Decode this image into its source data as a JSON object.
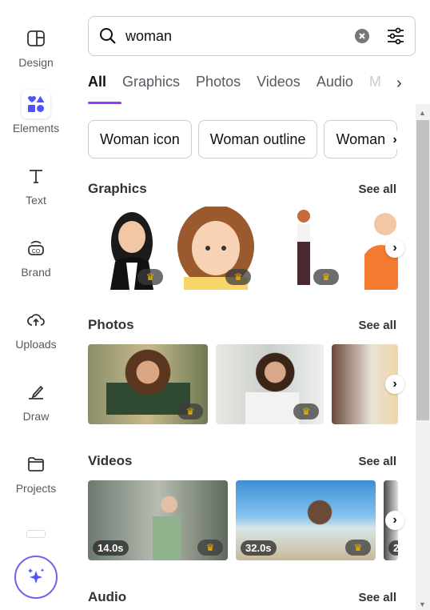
{
  "sidebar": {
    "items": [
      {
        "label": "Design",
        "icon": "layout-icon"
      },
      {
        "label": "Elements",
        "icon": "shapes-icon",
        "active": true
      },
      {
        "label": "Text",
        "icon": "text-icon"
      },
      {
        "label": "Brand",
        "icon": "brand-icon"
      },
      {
        "label": "Uploads",
        "icon": "cloud-upload-icon"
      },
      {
        "label": "Draw",
        "icon": "pen-icon"
      },
      {
        "label": "Projects",
        "icon": "folder-icon"
      }
    ],
    "magic_icon": "sparkles-icon"
  },
  "search": {
    "value": "woman",
    "placeholder": "Search"
  },
  "tabs": [
    "All",
    "Graphics",
    "Photos",
    "Videos",
    "Audio",
    "M"
  ],
  "chips": [
    "Woman icon",
    "Woman outline",
    "Woman"
  ],
  "sections": {
    "graphics": {
      "title": "Graphics",
      "see_all": "See all"
    },
    "photos": {
      "title": "Photos",
      "see_all": "See all"
    },
    "videos": {
      "title": "Videos",
      "see_all": "See all",
      "durations": [
        "14.0s",
        "32.0s",
        "2"
      ]
    },
    "audio": {
      "title": "Audio",
      "see_all": "See all"
    }
  },
  "colors": {
    "accent": "#8b3dff",
    "elements_icon": "#4c53ff",
    "crown": "#f6b500"
  }
}
